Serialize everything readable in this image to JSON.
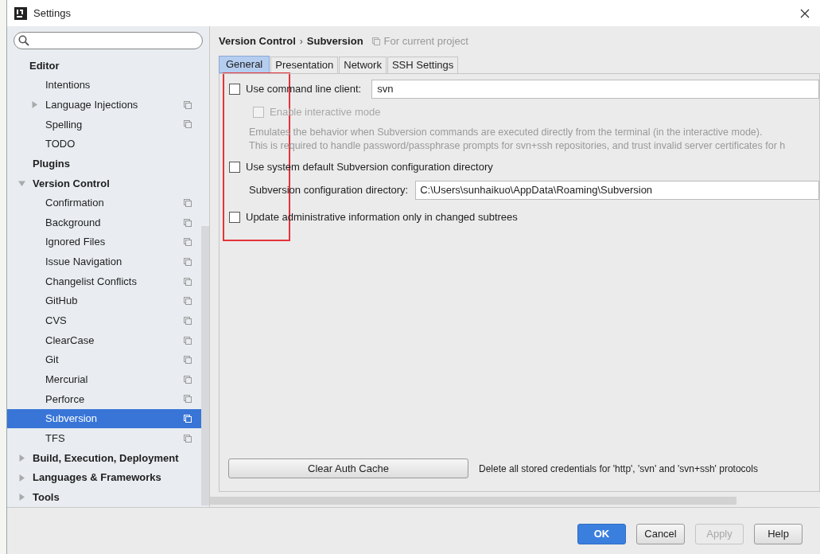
{
  "window": {
    "title": "Settings"
  },
  "sidebar": {
    "tree": [
      {
        "label": "Editor",
        "selected": false,
        "children": [
          {
            "label": "Intentions",
            "selected": false
          },
          {
            "label": "Language Injections",
            "expanded": false,
            "project_scope": true,
            "selected": false
          },
          {
            "label": "Spelling",
            "project_scope": true,
            "selected": false
          },
          {
            "label": "TODO",
            "selected": false
          }
        ]
      },
      {
        "label": "Plugins",
        "selected": false
      },
      {
        "label": "Version Control",
        "expanded": true,
        "selected": false,
        "children": [
          {
            "label": "Confirmation",
            "project_scope": true,
            "selected": false
          },
          {
            "label": "Background",
            "project_scope": true,
            "selected": false
          },
          {
            "label": "Ignored Files",
            "project_scope": true,
            "selected": false
          },
          {
            "label": "Issue Navigation",
            "project_scope": true,
            "selected": false
          },
          {
            "label": "Changelist Conflicts",
            "project_scope": true,
            "selected": false
          },
          {
            "label": "GitHub",
            "project_scope": true,
            "selected": false
          },
          {
            "label": "CVS",
            "project_scope": true,
            "selected": false
          },
          {
            "label": "ClearCase",
            "project_scope": true,
            "selected": false
          },
          {
            "label": "Git",
            "project_scope": true,
            "selected": false
          },
          {
            "label": "Mercurial",
            "project_scope": true,
            "selected": false
          },
          {
            "label": "Perforce",
            "project_scope": true,
            "selected": false
          },
          {
            "label": "Subversion",
            "project_scope": true,
            "selected": true
          },
          {
            "label": "TFS",
            "project_scope": true,
            "selected": false
          }
        ]
      },
      {
        "label": "Build, Execution, Deployment",
        "expanded": false,
        "selected": false
      },
      {
        "label": "Languages & Frameworks",
        "expanded": false,
        "selected": false
      },
      {
        "label": "Tools",
        "expanded": false,
        "selected": false
      }
    ]
  },
  "breadcrumb": {
    "parent": "Version Control",
    "separator": "›",
    "current": "Subversion",
    "scope": "For current project"
  },
  "tabs": [
    {
      "label": "General",
      "selected": true
    },
    {
      "label": "Presentation",
      "selected": false
    },
    {
      "label": "Network",
      "selected": false
    },
    {
      "label": "SSH Settings",
      "selected": false
    }
  ],
  "general": {
    "command_line": {
      "label": "Use command line client:",
      "checked": false,
      "value": "svn"
    },
    "interactive": {
      "label": "Enable interactive mode",
      "checked": false,
      "disabled": true
    },
    "description": [
      "Emulates the behavior when Subversion commands are executed directly from the terminal (in the interactive mode).",
      "This is required to handle password/passphrase prompts for svn+ssh repositories, and trust invalid server certificates for h"
    ],
    "system_default": {
      "label": "Use system default Subversion configuration directory",
      "checked": false
    },
    "config_dir": {
      "label": "Subversion configuration directory:",
      "value": "C:\\Users\\sunhaikuo\\AppData\\Roaming\\Subversion"
    },
    "update_admin": {
      "label": "Update administrative information only in changed subtrees",
      "checked": false
    },
    "clear_button": "Clear Auth Cache",
    "clear_note": "Delete all stored credentials for 'http', 'svn' and 'svn+ssh' protocols"
  },
  "buttons": [
    {
      "label": "OK",
      "default": true,
      "disabled": false
    },
    {
      "label": "Cancel",
      "default": false,
      "disabled": false
    },
    {
      "label": "Apply",
      "default": false,
      "disabled": true
    },
    {
      "label": "Help",
      "default": false,
      "disabled": false
    }
  ]
}
